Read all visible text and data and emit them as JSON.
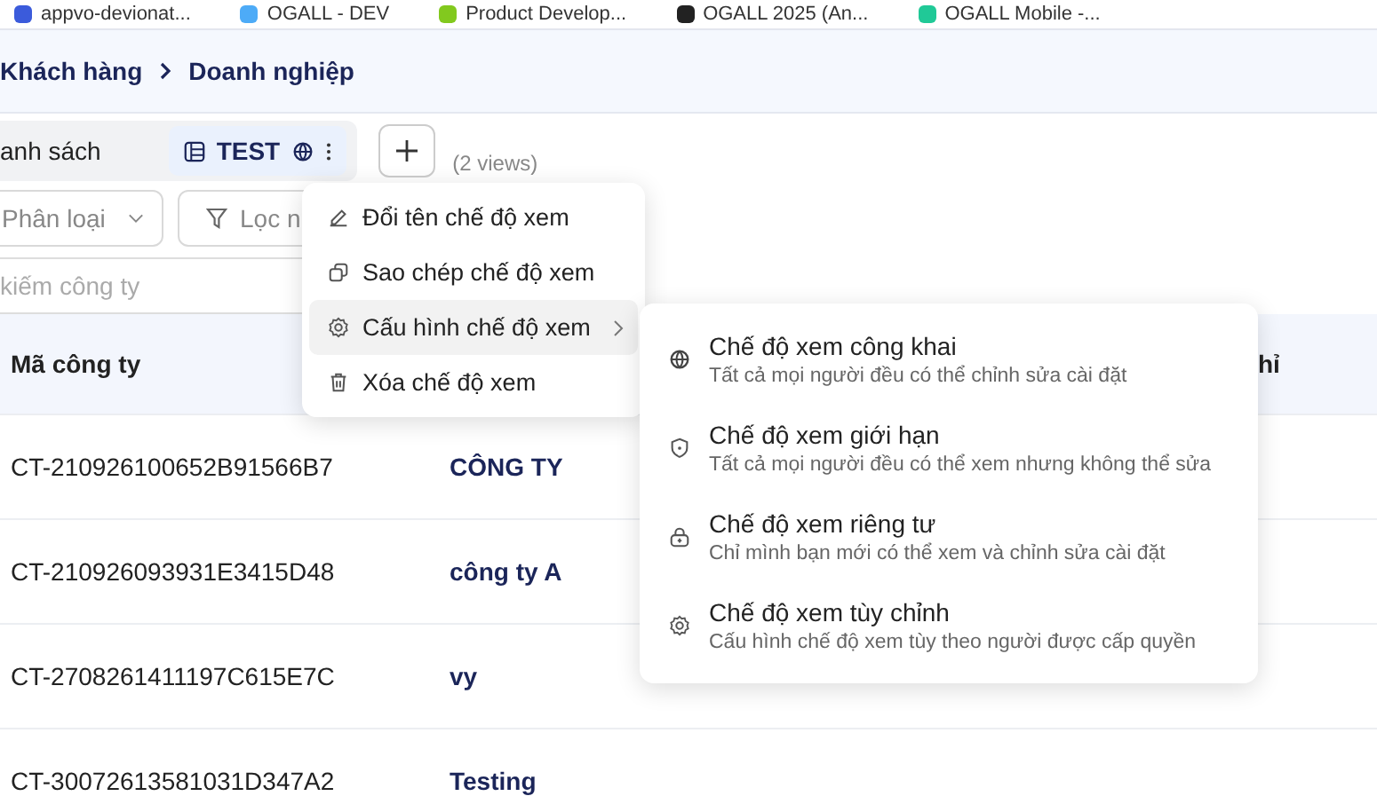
{
  "bookmarks": [
    {
      "label": "appvo-devionat...",
      "color": "#3b5bdb"
    },
    {
      "label": "OGALL - DEV",
      "color": "#4dabf7"
    },
    {
      "label": "Product Develop...",
      "color": "#82c91e"
    },
    {
      "label": "OGALL 2025 (An...",
      "color": "#222222"
    },
    {
      "label": "OGALL Mobile -...",
      "color": "#20c997"
    }
  ],
  "breadcrumb": [
    {
      "label": "Khách hàng"
    },
    {
      "label": "Doanh nghiệp"
    }
  ],
  "view_tabs": [
    {
      "label": "anh sách",
      "selected": false
    },
    {
      "label": "TEST",
      "selected": true
    }
  ],
  "views_count": "(2 views)",
  "filters": {
    "category": "Phân loại",
    "filter": "Lọc n"
  },
  "search": {
    "placeholder": "kiếm công ty"
  },
  "table": {
    "column_1": "Mã công ty",
    "column_3": "hỉ",
    "rows": [
      {
        "code": "CT-210926100652B91566B7",
        "name": "CÔNG TY"
      },
      {
        "code": "CT-210926093931E3415D48",
        "name": "công ty A"
      },
      {
        "code": "CT-2708261411197C615E7C",
        "name": "vy"
      },
      {
        "code": "CT-30072613581031D347A2",
        "name": "Testing"
      }
    ]
  },
  "context_menu": [
    {
      "label": "Đổi tên chế độ xem",
      "kind": "rename",
      "selected": false
    },
    {
      "label": "Sao chép chế độ xem",
      "kind": "copy",
      "selected": false
    },
    {
      "label": "Cấu hình chế độ xem",
      "kind": "configure",
      "selected": true
    },
    {
      "label": "Xóa chế độ xem",
      "kind": "delete",
      "selected": false
    }
  ],
  "submenu": [
    {
      "title": "Chế độ xem công khai",
      "description": "Tất cả mọi người đều có thể chỉnh sửa cài đặt",
      "kind": "public"
    },
    {
      "title": "Chế độ xem giới hạn",
      "description": "Tất cả mọi người đều có thể xem nhưng không thể sửa",
      "kind": "limited"
    },
    {
      "title": "Chế độ xem riêng tư",
      "description": "Chỉ mình bạn mới có thể xem và chỉnh sửa cài đặt",
      "kind": "private"
    },
    {
      "title": "Chế độ xem tùy chỉnh",
      "description": "Cấu hình chế độ xem tùy theo người được cấp quyền",
      "kind": "custom"
    }
  ]
}
